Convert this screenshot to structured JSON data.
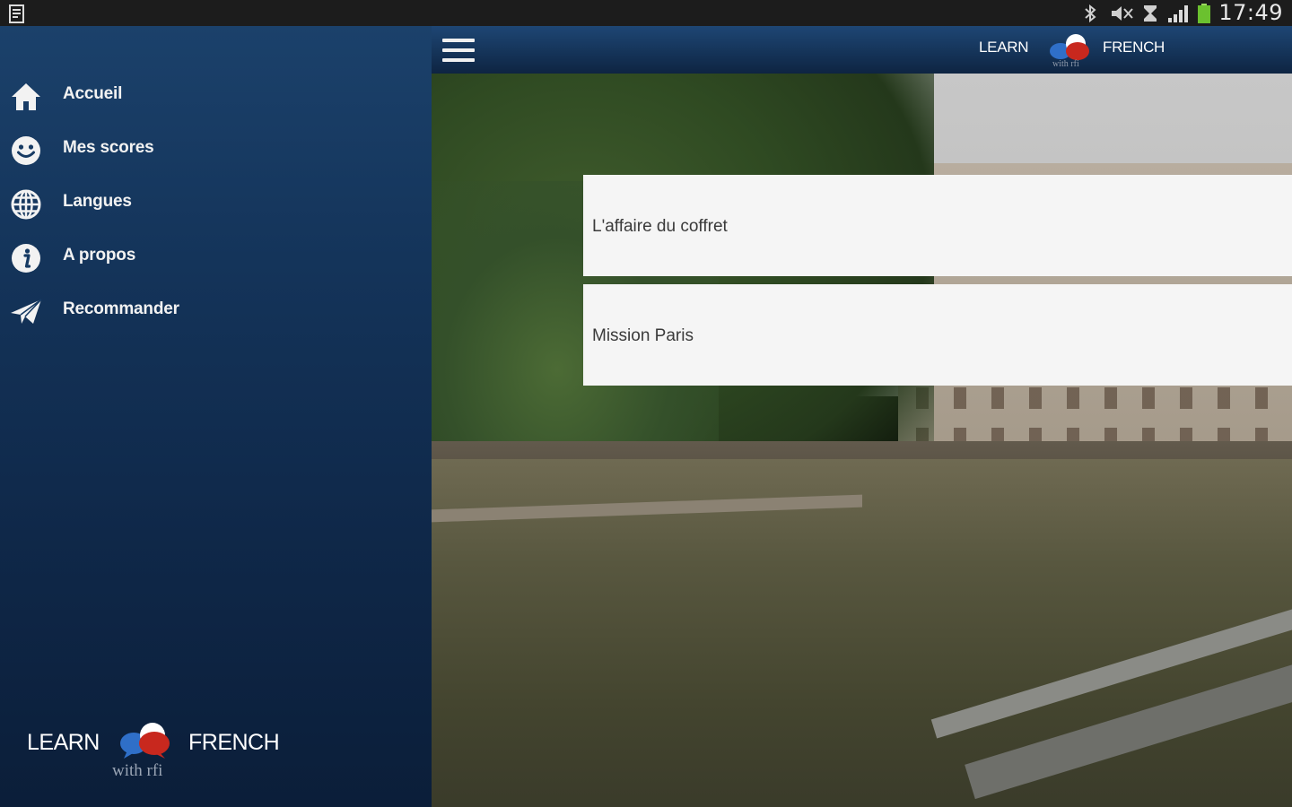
{
  "status_bar": {
    "time": "17:49",
    "icons": [
      "notification-icon",
      "bluetooth-icon",
      "mute-icon",
      "alarm-icon",
      "signal-icon",
      "battery-icon"
    ],
    "battery_color": "#6bc12f"
  },
  "drawer": {
    "items": [
      {
        "label": "Accueil",
        "icon": "home-icon"
      },
      {
        "label": "Mes scores",
        "icon": "smiley-icon"
      },
      {
        "label": "Langues",
        "icon": "globe-icon"
      },
      {
        "label": "A propos",
        "icon": "info-icon"
      },
      {
        "label": "Recommander",
        "icon": "send-icon"
      }
    ],
    "logo": {
      "left": "LEARN",
      "right": "FRENCH",
      "sub": "with rfi"
    }
  },
  "topbar": {
    "logo": {
      "left": "LEARN",
      "right": "FRENCH",
      "sub": "with rfi"
    }
  },
  "cards": [
    {
      "title": "L'affaire du coffret"
    },
    {
      "title": "Mission Paris"
    }
  ],
  "colors": {
    "drawer_top": "#1b416b",
    "drawer_bottom": "#0b1e39",
    "bubble_blue": "#2f6fc8",
    "bubble_red": "#c8281e",
    "card_bg": "#f5f5f5"
  }
}
